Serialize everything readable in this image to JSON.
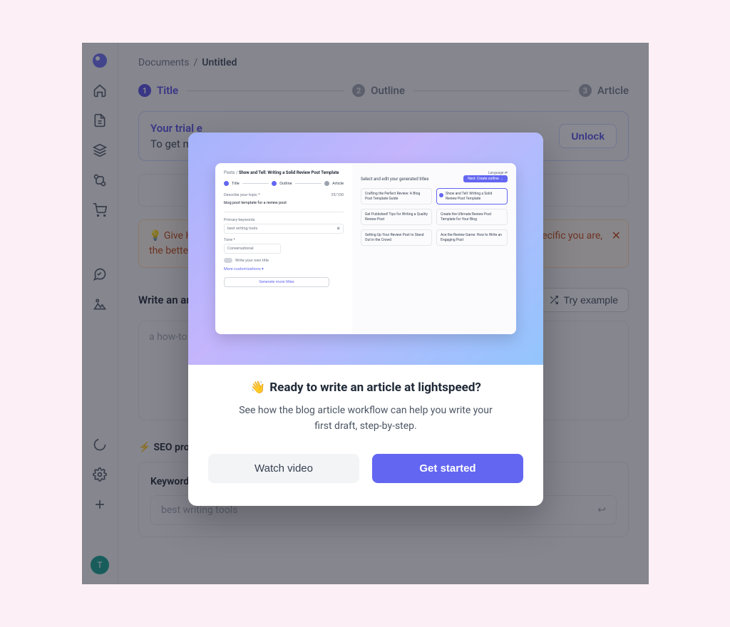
{
  "breadcrumb": {
    "root": "Documents",
    "sep": "/",
    "current": "Untitled"
  },
  "stepper": [
    {
      "n": "1",
      "label": "Title",
      "active": true
    },
    {
      "n": "2",
      "label": "Outline",
      "active": false
    },
    {
      "n": "3",
      "label": "Article",
      "active": false
    }
  ],
  "trial": {
    "line1": "Your trial e",
    "line2": "To get mo",
    "unlock": "Unlock"
  },
  "tip": {
    "prefix": "💡 Give Hypo",
    "suffix": "ecific you are,",
    "line2": "the better th"
  },
  "section1": {
    "title": "Write an ar",
    "try_example": "Try example",
    "placeholder": "a how-to"
  },
  "seo": {
    "title": "SEO pro",
    "kw_label": "Keywords",
    "kw_placeholder": "best writing tools"
  },
  "avatar": "T",
  "modal": {
    "mock": {
      "crumb_root": "Posts",
      "crumb_sep": "/",
      "crumb_current": "Show and Tell: Writing a Solid Review Post Template",
      "steps": [
        "Title",
        "Outline",
        "Article"
      ],
      "describe_label": "Describe your topic *",
      "describe_count": "35/100",
      "describe_value": "blog post template for a review post",
      "pk_label": "Primary keywords",
      "pk_value": "best writing tools",
      "tone_label": "Tone *",
      "tone_value": "Conversational",
      "write_own": "Write your own title",
      "more_custom": "More customizations ▾",
      "gen_more": "Generate more titles",
      "right_title": "Select and edit your generated titles",
      "language": "Language ⇄",
      "next": "Next: Create outline →",
      "cards": [
        "Crafting the Perfect Review: A Blog Post Template Guide",
        "Show and Tell: Writing a Solid Review Post Template",
        "Get Published! Tips for Writing a Quality Review Post",
        "Create the Ultimate Review Post Template for Your Blog",
        "Setting Up Your Review Post to Stand Out in the Crowd",
        "Ace the Review Game: How to Write an Engaging Post"
      ]
    },
    "hand": "👋",
    "title": "Ready to write an article at lightspeed?",
    "desc": "See how the blog article workflow can help you write your first draft, step-by-step.",
    "watch": "Watch video",
    "get_started": "Get started"
  }
}
